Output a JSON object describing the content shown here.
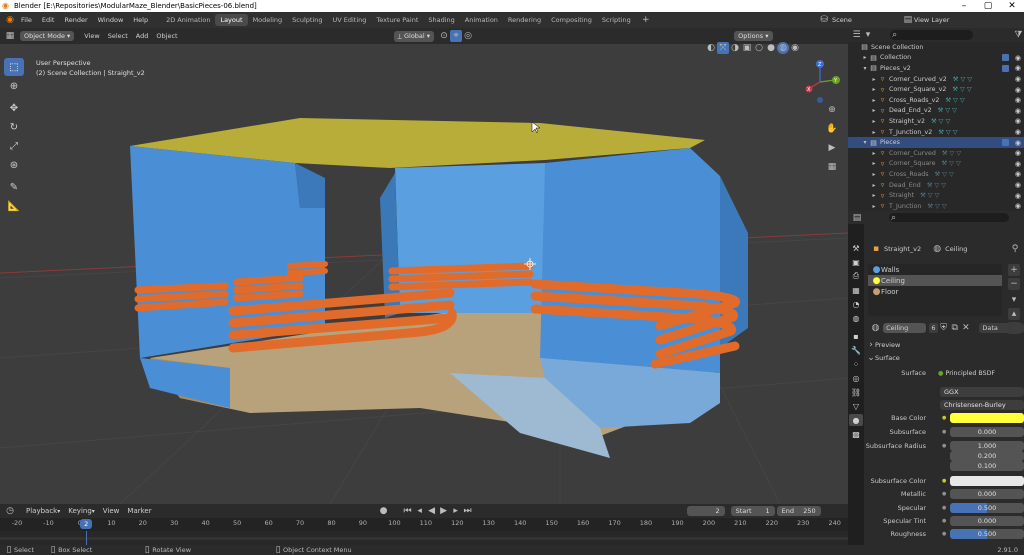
{
  "titlebar": {
    "title": "Blender [E:\\Repositories\\ModularMaze_Blender\\BasicPieces-06.blend]",
    "minimize": "–",
    "maximize": "▢",
    "close": "✕"
  },
  "menu": {
    "items": [
      "File",
      "Edit",
      "Render",
      "Window",
      "Help"
    ]
  },
  "workspaces": [
    "2D Animation",
    "Layout",
    "Modeling",
    "Sculpting",
    "UV Editing",
    "Texture Paint",
    "Shading",
    "Animation",
    "Rendering",
    "Compositing",
    "Scripting"
  ],
  "active_workspace": "Layout",
  "scene": {
    "name": "Scene",
    "view_layer": "View Layer"
  },
  "viewport": {
    "mode": "Object Mode",
    "menus": [
      "View",
      "Select",
      "Add",
      "Object"
    ],
    "orientation": "Global",
    "options": "Options",
    "info_line1": "User Perspective",
    "info_line2": "(2) Scene Collection | Straight_v2",
    "gizmo": {
      "x": "X",
      "y": "Y",
      "z": "Z"
    }
  },
  "outliner": {
    "rows": [
      {
        "label": "Scene Collection",
        "indent": 0
      },
      {
        "label": "Collection",
        "indent": 1
      },
      {
        "label": "Pieces_v2",
        "indent": 1
      },
      {
        "label": "Corner_Curved_v2",
        "indent": 2
      },
      {
        "label": "Corner_Square_v2",
        "indent": 2
      },
      {
        "label": "Cross_Roads_v2",
        "indent": 2
      },
      {
        "label": "Dead_End_v2",
        "indent": 2
      },
      {
        "label": "Straight_v2",
        "indent": 2
      },
      {
        "label": "T_Junction_v2",
        "indent": 2
      },
      {
        "label": "Pieces",
        "indent": 1
      },
      {
        "label": "Corner_Curved",
        "indent": 2
      },
      {
        "label": "Corner_Square",
        "indent": 2
      },
      {
        "label": "Cross_Roads",
        "indent": 2
      },
      {
        "label": "Dead_End",
        "indent": 2
      },
      {
        "label": "Straight",
        "indent": 2
      },
      {
        "label": "T_Junction",
        "indent": 2
      }
    ]
  },
  "properties": {
    "object": "Straight_v2",
    "material": "Ceiling",
    "slots": [
      "Walls",
      "Ceiling",
      "Floor"
    ],
    "active_slot": "Ceiling",
    "users": "6",
    "link": "Data",
    "preview": "Preview",
    "surface_header": "Surface",
    "surface_label": "Surface",
    "surface_value": "Principled BSDF",
    "distribution": "GGX",
    "subsurface_method": "Christensen-Burley",
    "fields": [
      {
        "label": "Base Color",
        "value": "",
        "color": "#ffff3a"
      },
      {
        "label": "Subsurface",
        "value": "0.000"
      },
      {
        "label": "Subsurface Radius",
        "value": "1.000"
      },
      {
        "label": "",
        "value": "0.200"
      },
      {
        "label": "",
        "value": "0.100"
      },
      {
        "label": "Subsurface Color",
        "value": "",
        "color": "#e8e8e8"
      },
      {
        "label": "Metallic",
        "value": "0.000"
      },
      {
        "label": "Specular",
        "value": "0.500",
        "fill": 0.5
      },
      {
        "label": "Specular Tint",
        "value": "0.000"
      },
      {
        "label": "Roughness",
        "value": "0.500",
        "fill": 0.5
      }
    ]
  },
  "timeline": {
    "menus": [
      "Playback",
      "Keying",
      "View",
      "Marker"
    ],
    "current_frame": "2",
    "start_label": "Start",
    "start": "1",
    "end_label": "End",
    "end": "250",
    "ticks": [
      "-20",
      "-10",
      "0",
      "10",
      "20",
      "30",
      "40",
      "50",
      "60",
      "70",
      "80",
      "90",
      "100",
      "110",
      "120",
      "130",
      "140",
      "150",
      "160",
      "170",
      "180",
      "190",
      "200",
      "210",
      "220",
      "230",
      "240"
    ],
    "ruler_current": "2"
  },
  "statusbar": {
    "items": [
      "Select",
      "Box Select",
      "Rotate View",
      "Object Context Menu"
    ],
    "version": "2.91.0"
  }
}
